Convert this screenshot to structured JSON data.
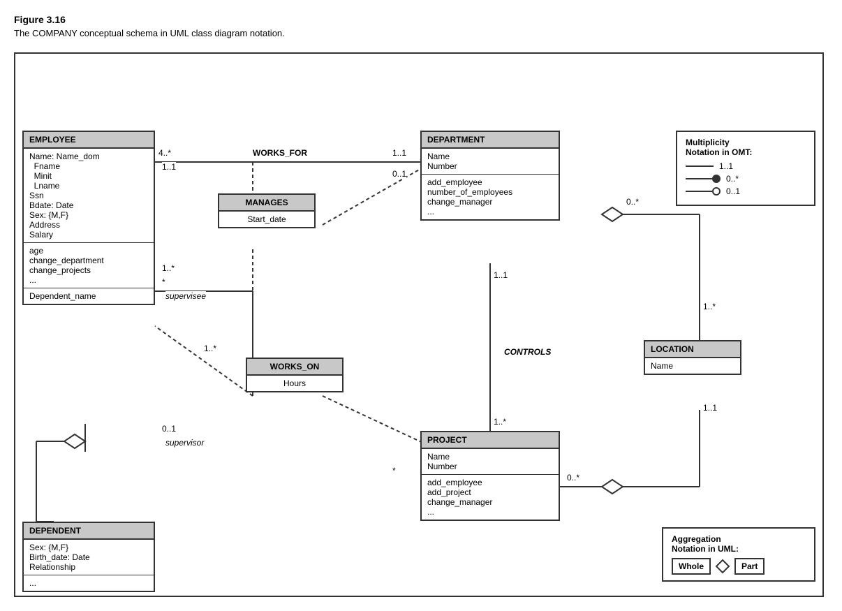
{
  "figure": {
    "title": "Figure 3.16",
    "caption": "The COMPANY conceptual schema in UML class diagram notation."
  },
  "classes": {
    "employee": {
      "header": "EMPLOYEE",
      "section1": [
        "Name: Name_dom",
        "  Fname",
        "  Minit",
        "  Lname",
        "Ssn",
        "Bdate: Date",
        "Sex: {M,F}",
        "Address",
        "Salary"
      ],
      "section2": [
        "age",
        "change_department",
        "change_projects",
        "..."
      ],
      "section3": [
        "Dependent_name"
      ]
    },
    "department": {
      "header": "DEPARTMENT",
      "section1": [
        "Name",
        "Number"
      ],
      "section2": [
        "add_employee",
        "number_of_employees",
        "change_manager",
        "..."
      ]
    },
    "project": {
      "header": "PROJECT",
      "section1": [
        "Name",
        "Number"
      ],
      "section2": [
        "add_employee",
        "add_project",
        "change_manager",
        "..."
      ]
    },
    "dependent": {
      "header": "DEPENDENT",
      "section1": [
        "Sex: {M,F}",
        "Birth_date: Date",
        "Relationship"
      ],
      "section2": [
        "..."
      ]
    },
    "location": {
      "header": "LOCATION",
      "section1": [
        "Name"
      ]
    }
  },
  "relationships": {
    "manages": {
      "header": "MANAGES",
      "section": "Start_date"
    },
    "works_on": {
      "header": "WORKS_ON",
      "section": "Hours"
    },
    "works_for": "WORKS_FOR",
    "controls": "CONTROLS"
  },
  "multiplicities": {
    "works_for_emp": "4..*",
    "works_for_dep": "1..1",
    "manages_emp": "1..1",
    "manages_dep": "0..1",
    "supervises_star": "*",
    "supervises_sup": "0..1",
    "supervisee_label": "supervisee",
    "supervisor_label": "supervisor",
    "supervises_emp": "1..*",
    "works_on_emp": "1..*",
    "works_on_proj": "*",
    "controls_dep": "1..1",
    "controls_proj": "1..*",
    "dep_location": "0..*",
    "location_dep": "1..*",
    "location_loc": "1..1"
  },
  "notation": {
    "title1": "Multiplicity",
    "title2": "Notation in OMT:",
    "rows": [
      {
        "line": "plain",
        "label": "1..1"
      },
      {
        "line": "dot",
        "label": "0..*"
      },
      {
        "line": "circle",
        "label": "0..1"
      }
    ]
  },
  "aggregation": {
    "title1": "Aggregation",
    "title2": "Notation in UML:",
    "whole_label": "Whole",
    "part_label": "Part"
  }
}
